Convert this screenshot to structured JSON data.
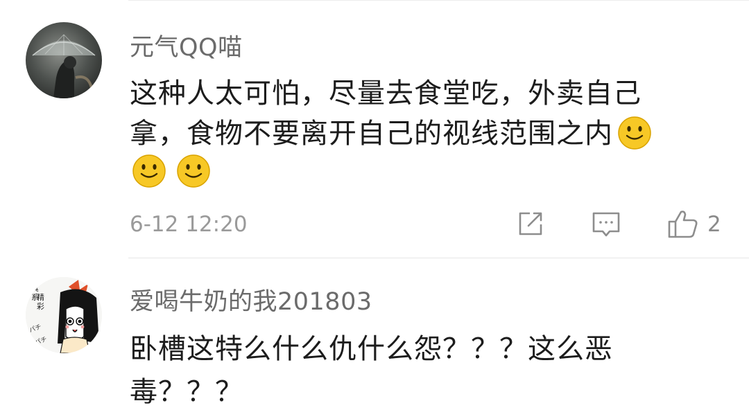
{
  "comments": [
    {
      "username": "元气QQ喵",
      "text_lines": [
        "这种人太可怕，尽量去食堂吃，外卖自己",
        "拿，食物不要离开自己的视线范围之内"
      ],
      "emoji_icon": "smile-emoji-icon",
      "timestamp": "6-12 12:20",
      "like_count": "2",
      "avatar_icon": "umbrella-photo-avatar"
    },
    {
      "username": "爱喝牛奶的我201803",
      "text_lines": [
        "卧槽这特么什么仇什么怨？？？这么恶",
        "毒？？？"
      ],
      "avatar_icon": "anime-girl-avatar",
      "avatar_text": "真系精彩",
      "avatar_sound": "パチパチ"
    }
  ],
  "colors": {
    "username": "#6b6b6b",
    "body_text": "#1c1c1c",
    "meta": "#9a9a9a",
    "divider": "#e6e6e6",
    "emoji_face": "#f5c518"
  }
}
